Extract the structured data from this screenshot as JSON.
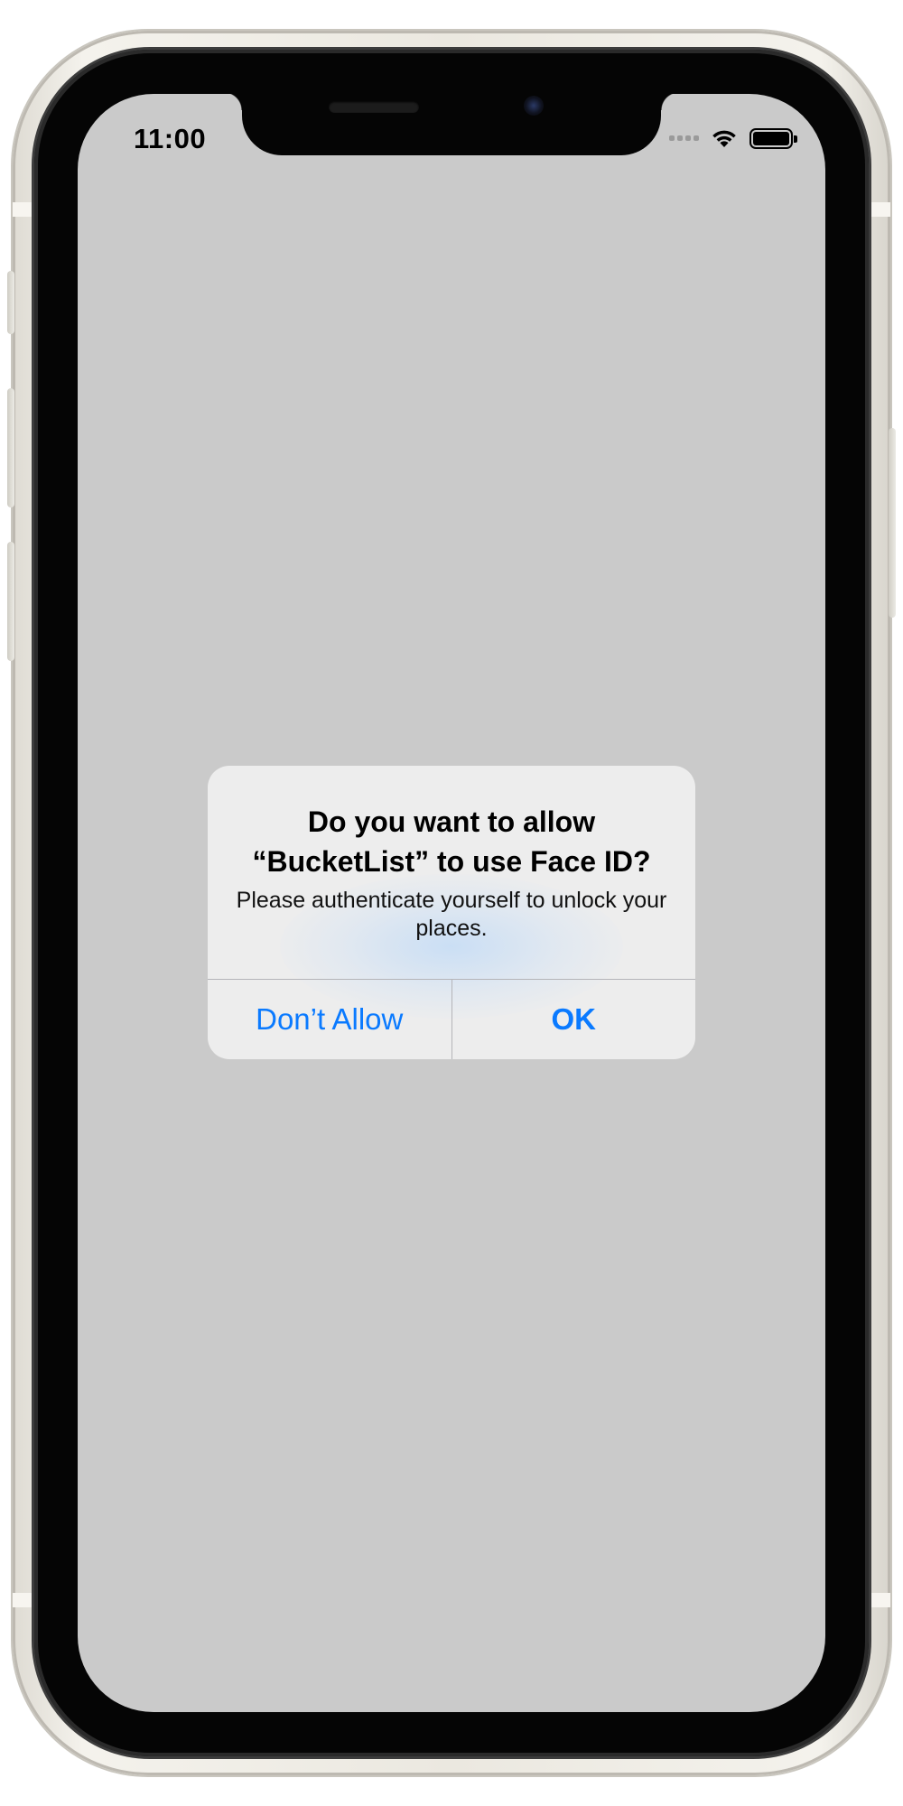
{
  "status_bar": {
    "time": "11:00",
    "icons": [
      "cellular-signal-icon",
      "wifi-icon",
      "battery-icon"
    ]
  },
  "alert": {
    "title": "Do you want to allow “BucketList” to use Face ID?",
    "message": "Please authenticate yourself to unlock your places.",
    "buttons": {
      "dont_allow": "Don’t Allow",
      "ok": "OK"
    }
  },
  "colors": {
    "screen_background": "#cacaca",
    "alert_background": "#ededed",
    "accent": "#0a7aff",
    "device_frame": "#ebe8e0"
  }
}
